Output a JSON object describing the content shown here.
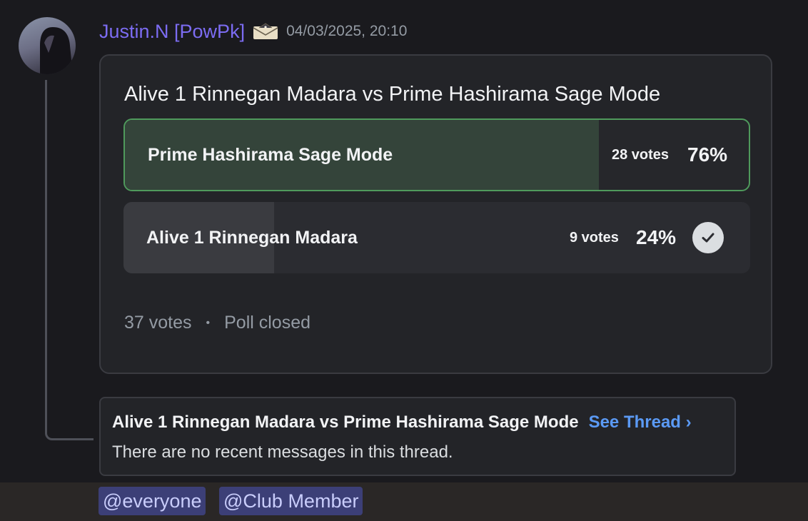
{
  "message": {
    "author": "Justin.N [PowPk]",
    "badge_icon": "envelope-badge-icon",
    "timestamp": "04/03/2025, 20:10"
  },
  "poll": {
    "question": "Alive 1 Rinnegan Madara vs Prime Hashirama Sage Mode",
    "answers": [
      {
        "label": "Prime Hashirama Sage Mode",
        "votes": "28 votes",
        "percent": "76%",
        "fill_fraction": 0.76,
        "winner": true
      },
      {
        "label": "Alive 1 Rinnegan Madara",
        "votes": "9 votes",
        "percent": "24%",
        "fill_fraction": 0.24,
        "voted": true
      }
    ],
    "total_votes": "37 votes",
    "separator": "•",
    "status": "Poll closed"
  },
  "thread": {
    "title": "Alive 1 Rinnegan Madara vs Prime Hashirama Sage Mode",
    "link": "See Thread ›",
    "subtitle": "There are no recent messages in this thread."
  },
  "mentions": [
    "@everyone",
    "@Club Member"
  ],
  "colors": {
    "username": "#7c6cf2",
    "winner_border": "#4f9a5c",
    "link": "#5b9af5",
    "mention_bg": "#3c3f77"
  }
}
